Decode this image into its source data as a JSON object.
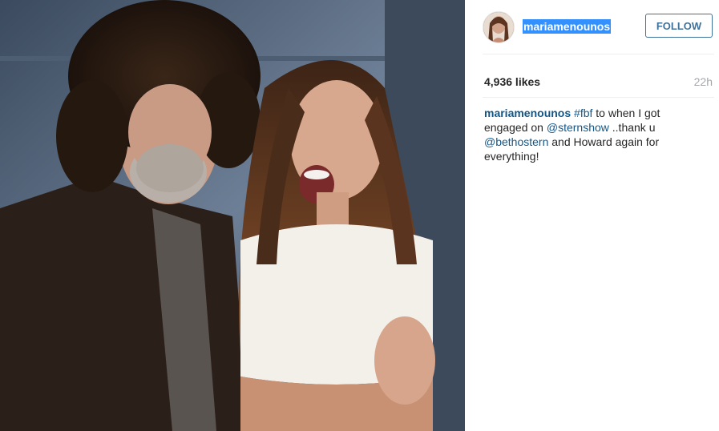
{
  "post": {
    "username": "mariamenounos",
    "follow_label": "FOLLOW",
    "likes": "4,936 likes",
    "timestamp": "22h"
  },
  "caption": {
    "author": "mariamenounos",
    "hashtag": "#fbf",
    "text1": " to when I got engaged on ",
    "mention1": "@sternshow",
    "text2": " ..thank u ",
    "mention2": "@bethostern",
    "text3": " and Howard again for everything!"
  },
  "colors": {
    "link": "#125688",
    "follow": "#3f729b",
    "selection": "#3390ff"
  },
  "icons": {
    "avatar": "profile-photo"
  }
}
